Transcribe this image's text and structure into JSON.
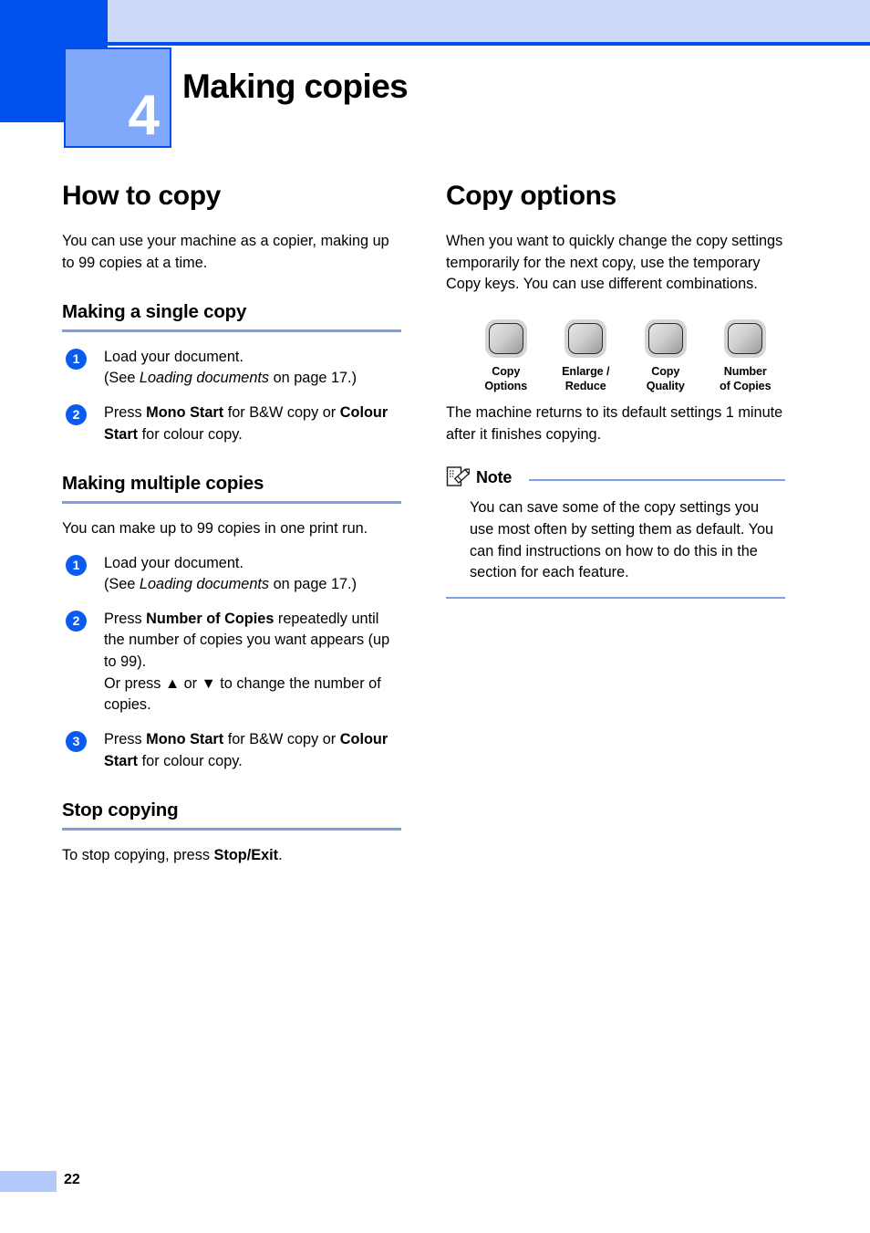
{
  "chapter": {
    "number": "4",
    "title": "Making copies"
  },
  "left_column": {
    "section_title": "How to copy",
    "intro": "You can use your machine as a copier, making up to 99 copies at a time.",
    "subsections": [
      {
        "heading": "Making a single copy",
        "steps": [
          {
            "num": "1",
            "parts": [
              {
                "t": "Load your document.",
                "style": "normal"
              },
              {
                "t": "\n(See ",
                "style": "normal"
              },
              {
                "t": "Loading documents",
                "style": "italic"
              },
              {
                "t": " on page 17.)",
                "style": "normal"
              }
            ]
          },
          {
            "num": "2",
            "parts": [
              {
                "t": "Press ",
                "style": "normal"
              },
              {
                "t": "Mono Start",
                "style": "bold"
              },
              {
                "t": " for B&W copy or ",
                "style": "normal"
              },
              {
                "t": "Colour Start",
                "style": "bold"
              },
              {
                "t": " for colour copy.",
                "style": "normal"
              }
            ]
          }
        ]
      },
      {
        "heading": "Making multiple copies",
        "intro": "You can make up to 99 copies in one print run.",
        "steps": [
          {
            "num": "1",
            "parts": [
              {
                "t": "Load your document.",
                "style": "normal"
              },
              {
                "t": "\n(See ",
                "style": "normal"
              },
              {
                "t": "Loading documents",
                "style": "italic"
              },
              {
                "t": " on page 17.)",
                "style": "normal"
              }
            ]
          },
          {
            "num": "2",
            "parts": [
              {
                "t": "Press ",
                "style": "normal"
              },
              {
                "t": "Number of Copies",
                "style": "bold"
              },
              {
                "t": " repeatedly until the number of copies you want appears (up to 99).",
                "style": "normal"
              },
              {
                "t": "\nOr press ▲ or ▼ to change the number of copies.",
                "style": "normal"
              }
            ]
          },
          {
            "num": "3",
            "parts": [
              {
                "t": "Press ",
                "style": "normal"
              },
              {
                "t": "Mono Start",
                "style": "bold"
              },
              {
                "t": " for B&W copy or ",
                "style": "normal"
              },
              {
                "t": "Colour Start",
                "style": "bold"
              },
              {
                "t": " for colour copy.",
                "style": "normal"
              }
            ]
          }
        ]
      },
      {
        "heading": "Stop copying",
        "paragraph_parts": [
          {
            "t": "To stop copying, press ",
            "style": "normal"
          },
          {
            "t": "Stop/Exit",
            "style": "bold"
          },
          {
            "t": ".",
            "style": "normal"
          }
        ]
      }
    ]
  },
  "right_column": {
    "section_title": "Copy options",
    "intro": "When you want to quickly change the copy settings temporarily for the next copy, use the temporary Copy keys. You can use different combinations.",
    "keys": [
      {
        "icon": "printer-key-icon",
        "line1": "Copy",
        "line2": "Options"
      },
      {
        "icon": "printer-key-icon",
        "line1": "Enlarge /",
        "line2": "Reduce"
      },
      {
        "icon": "printer-key-icon",
        "line1": "Copy",
        "line2": "Quality"
      },
      {
        "icon": "printer-key-icon",
        "line1": "Number",
        "line2": "of Copies"
      }
    ],
    "after_keys": "The machine returns to its default settings 1 minute after it finishes copying.",
    "note": {
      "icon": "note-pencil-icon",
      "title": "Note",
      "body": "You can save some of the copy settings you use most often by setting them as default. You can find instructions on how to do this in the section for each feature."
    }
  },
  "footer": {
    "page_number": "22"
  },
  "colors": {
    "brand_blue": "#0050f0",
    "header_light": "#cddaf8",
    "chapter_box": "#80a8fb",
    "rule_blue": "#7f9fe4",
    "badge_blue": "#0a5bf0",
    "footer_block": "#b4c9fb"
  }
}
